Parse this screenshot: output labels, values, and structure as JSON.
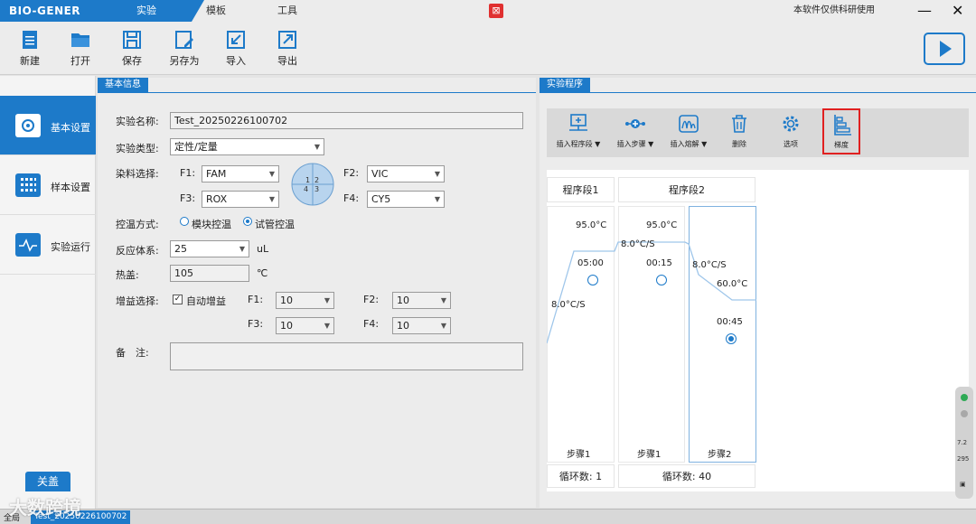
{
  "app": {
    "logo": "BIO-GENER",
    "tabs": [
      "实验",
      "模板",
      "工具"
    ],
    "active_tab": "实验",
    "notice": "本软件仅供科研使用",
    "minimize": "—",
    "close": "✕"
  },
  "toolbar": {
    "items": [
      {
        "label": "新建",
        "icon": "new-file-icon"
      },
      {
        "label": "打开",
        "icon": "folder-icon"
      },
      {
        "label": "保存",
        "icon": "save-icon"
      },
      {
        "label": "另存为",
        "icon": "save-as-icon"
      },
      {
        "label": "导入",
        "icon": "import-icon"
      },
      {
        "label": "导出",
        "icon": "export-icon"
      }
    ]
  },
  "sidebar": {
    "items": [
      {
        "label": "基本设置",
        "icon": "gear-icon",
        "active": true
      },
      {
        "label": "样本设置",
        "icon": "grid-icon",
        "active": false
      },
      {
        "label": "实验运行",
        "icon": "pulse-icon",
        "active": false
      }
    ],
    "about": "关盖"
  },
  "basic": {
    "header": "基本信息",
    "name_label": "实验名称:",
    "name_value": "Test_20250226100702",
    "type_label": "实验类型:",
    "type_value": "定性/定量",
    "dye_label": "染料选择:",
    "f1_label": "F1:",
    "f1_value": "FAM",
    "f2_label": "F2:",
    "f2_value": "VIC",
    "f3_label": "F3:",
    "f3_value": "ROX",
    "f4_label": "F4:",
    "f4_value": "CY5",
    "quadrants": [
      "1",
      "2",
      "4",
      "3"
    ],
    "temp_label": "控温方式:",
    "temp_option1": "模块控温",
    "temp_option2": "试管控温",
    "volume_label": "反应体系:",
    "volume_value": "25",
    "volume_unit": "uL",
    "lid_label": "热盖:",
    "lid_value": "105",
    "lid_unit": "℃",
    "gain_label": "增益选择:",
    "auto_gain": "自动增益",
    "g1_label": "F1:",
    "g1_value": "10",
    "g2_label": "F2:",
    "g2_value": "10",
    "g3_label": "F3:",
    "g3_value": "10",
    "g4_label": "F4:",
    "g4_value": "10",
    "notes_label": "备　注:"
  },
  "program": {
    "header": "实验程序",
    "tools": [
      {
        "label": "插入程序段 ▼",
        "icon": "insert-stage-icon"
      },
      {
        "label": "插入步骤 ▼",
        "icon": "insert-step-icon"
      },
      {
        "label": "插入熔解 ▼",
        "icon": "insert-melt-icon"
      },
      {
        "label": "删除",
        "icon": "trash-icon"
      },
      {
        "label": "选项",
        "icon": "options-gear-icon"
      },
      {
        "label": "梯度",
        "icon": "gradient-icon"
      }
    ],
    "stages": [
      {
        "name": "程序段1",
        "cycles": "循环数:  1"
      },
      {
        "name": "程序段2",
        "cycles": "循环数:  40"
      }
    ],
    "steps": [
      {
        "label": "步骤1",
        "temp": "95.0°C",
        "time": "05:00",
        "rate": "8.0°C/S"
      },
      {
        "label": "步骤1",
        "temp": "95.0°C",
        "time": "00:15",
        "rate": "8.0°C/S"
      },
      {
        "label": "步骤2",
        "temp": "60.0°C",
        "time": "00:45",
        "rate": "8.0°C/S"
      }
    ]
  },
  "status": {
    "left": "全局",
    "file": "Test_20250226100702",
    "watermark": "大数跨境"
  },
  "widget": {
    "v1": "7.2",
    "v2": "295"
  }
}
